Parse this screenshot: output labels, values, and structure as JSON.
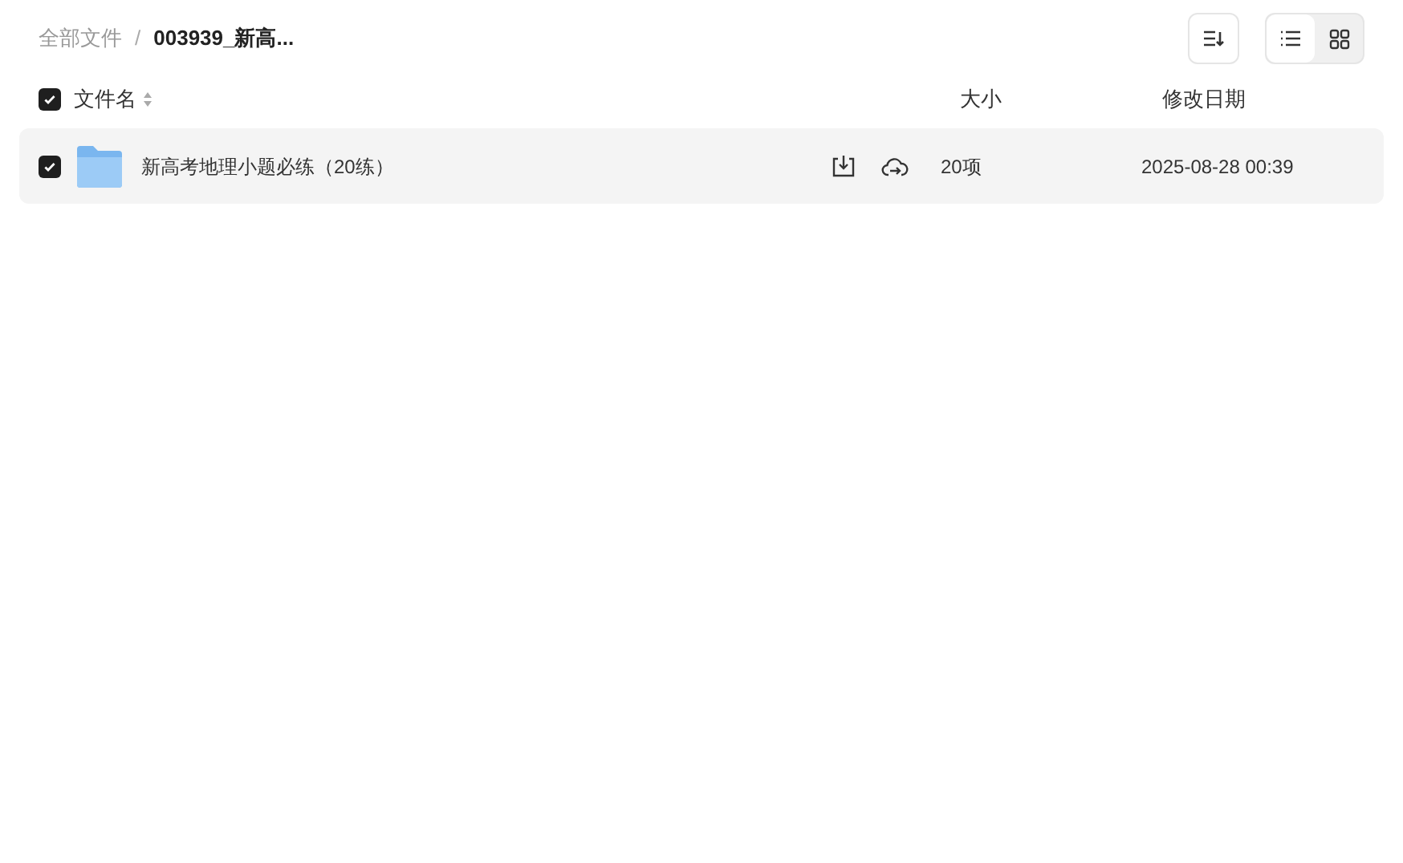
{
  "breadcrumb": [
    {
      "label": "全部文件",
      "current": false
    },
    {
      "separator": "/",
      "label": "003939_新高...",
      "current": true
    }
  ],
  "view_modes": [
    {
      "kind": "list",
      "selected": true
    },
    {
      "kind": "grid",
      "selected": false
    }
  ],
  "table": {
    "select_all": {
      "checked": true
    },
    "columns": [
      {
        "label": "文件名"
      },
      {
        "label": "大小"
      },
      {
        "label": "修改日期"
      }
    ],
    "rows": [
      {
        "checked": true,
        "name": "新高考地理小题必练（20练）",
        "size": "20项",
        "modified": "2025-08-28 00:39"
      }
    ]
  }
}
